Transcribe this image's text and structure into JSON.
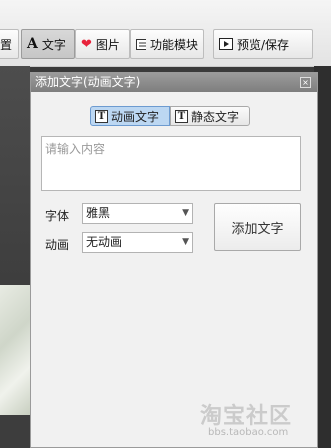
{
  "toolbar": {
    "items": [
      {
        "label": "置",
        "icon": ""
      },
      {
        "label": "文字",
        "icon": "text-a-icon"
      },
      {
        "label": "图片",
        "icon": "heart-icon"
      },
      {
        "label": "功能模块",
        "icon": "module-icon"
      },
      {
        "label": "预览/保存",
        "icon": "play-icon"
      }
    ]
  },
  "dialog": {
    "title": "添加文字(动画文字)",
    "tabs": [
      {
        "label": "动画文字",
        "active": true
      },
      {
        "label": "静态文字",
        "active": false
      }
    ],
    "text_input": {
      "placeholder": "请输入内容",
      "value": ""
    },
    "font": {
      "label": "字体",
      "value": "雅黑"
    },
    "animation": {
      "label": "动画",
      "value": "无动画"
    },
    "add_button": "添加文字"
  },
  "watermark": {
    "main": "淘宝社区",
    "sub": "bbs.taobao.com"
  },
  "colors": {
    "dialog_title_bar": "#8c8c8c",
    "active_tab": "#bcd7f2",
    "heart": "#e8233b"
  }
}
